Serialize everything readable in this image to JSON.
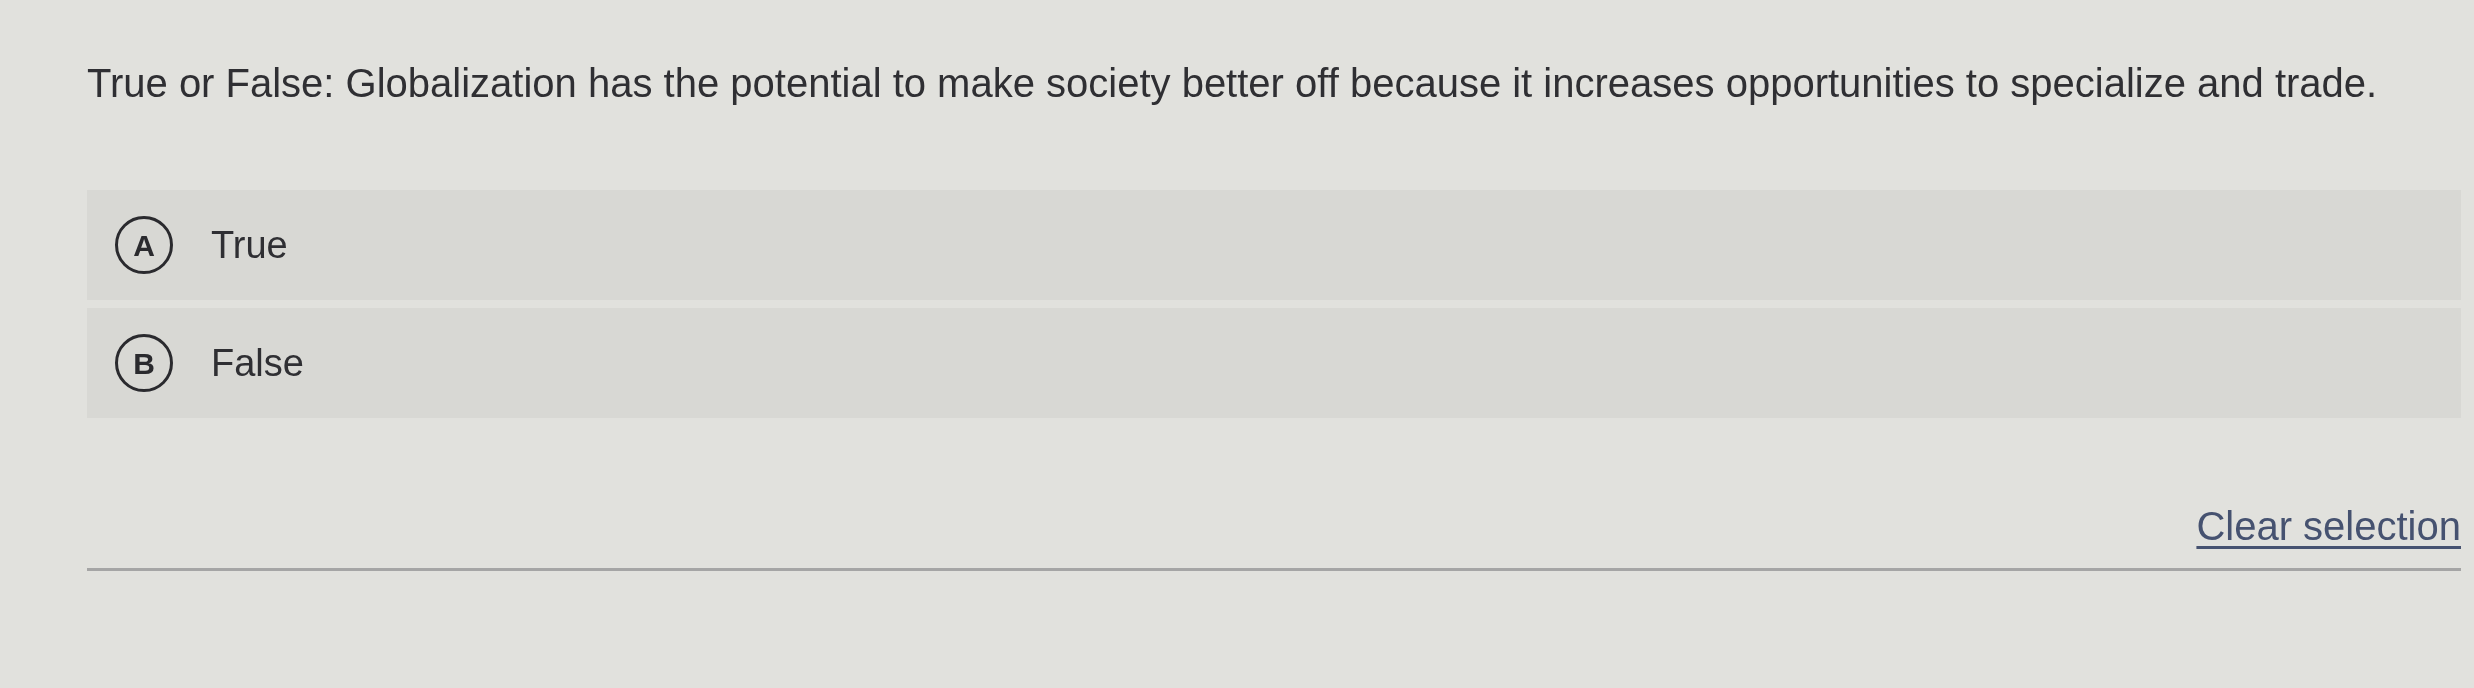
{
  "question": {
    "text": "True or False: Globalization has the potential to make society better off because it increases opportunities to specialize and trade."
  },
  "options": [
    {
      "letter": "A",
      "label": "True",
      "selected": false
    },
    {
      "letter": "B",
      "label": "False",
      "selected": false
    }
  ],
  "clear_selection": {
    "label": "Clear selection"
  }
}
